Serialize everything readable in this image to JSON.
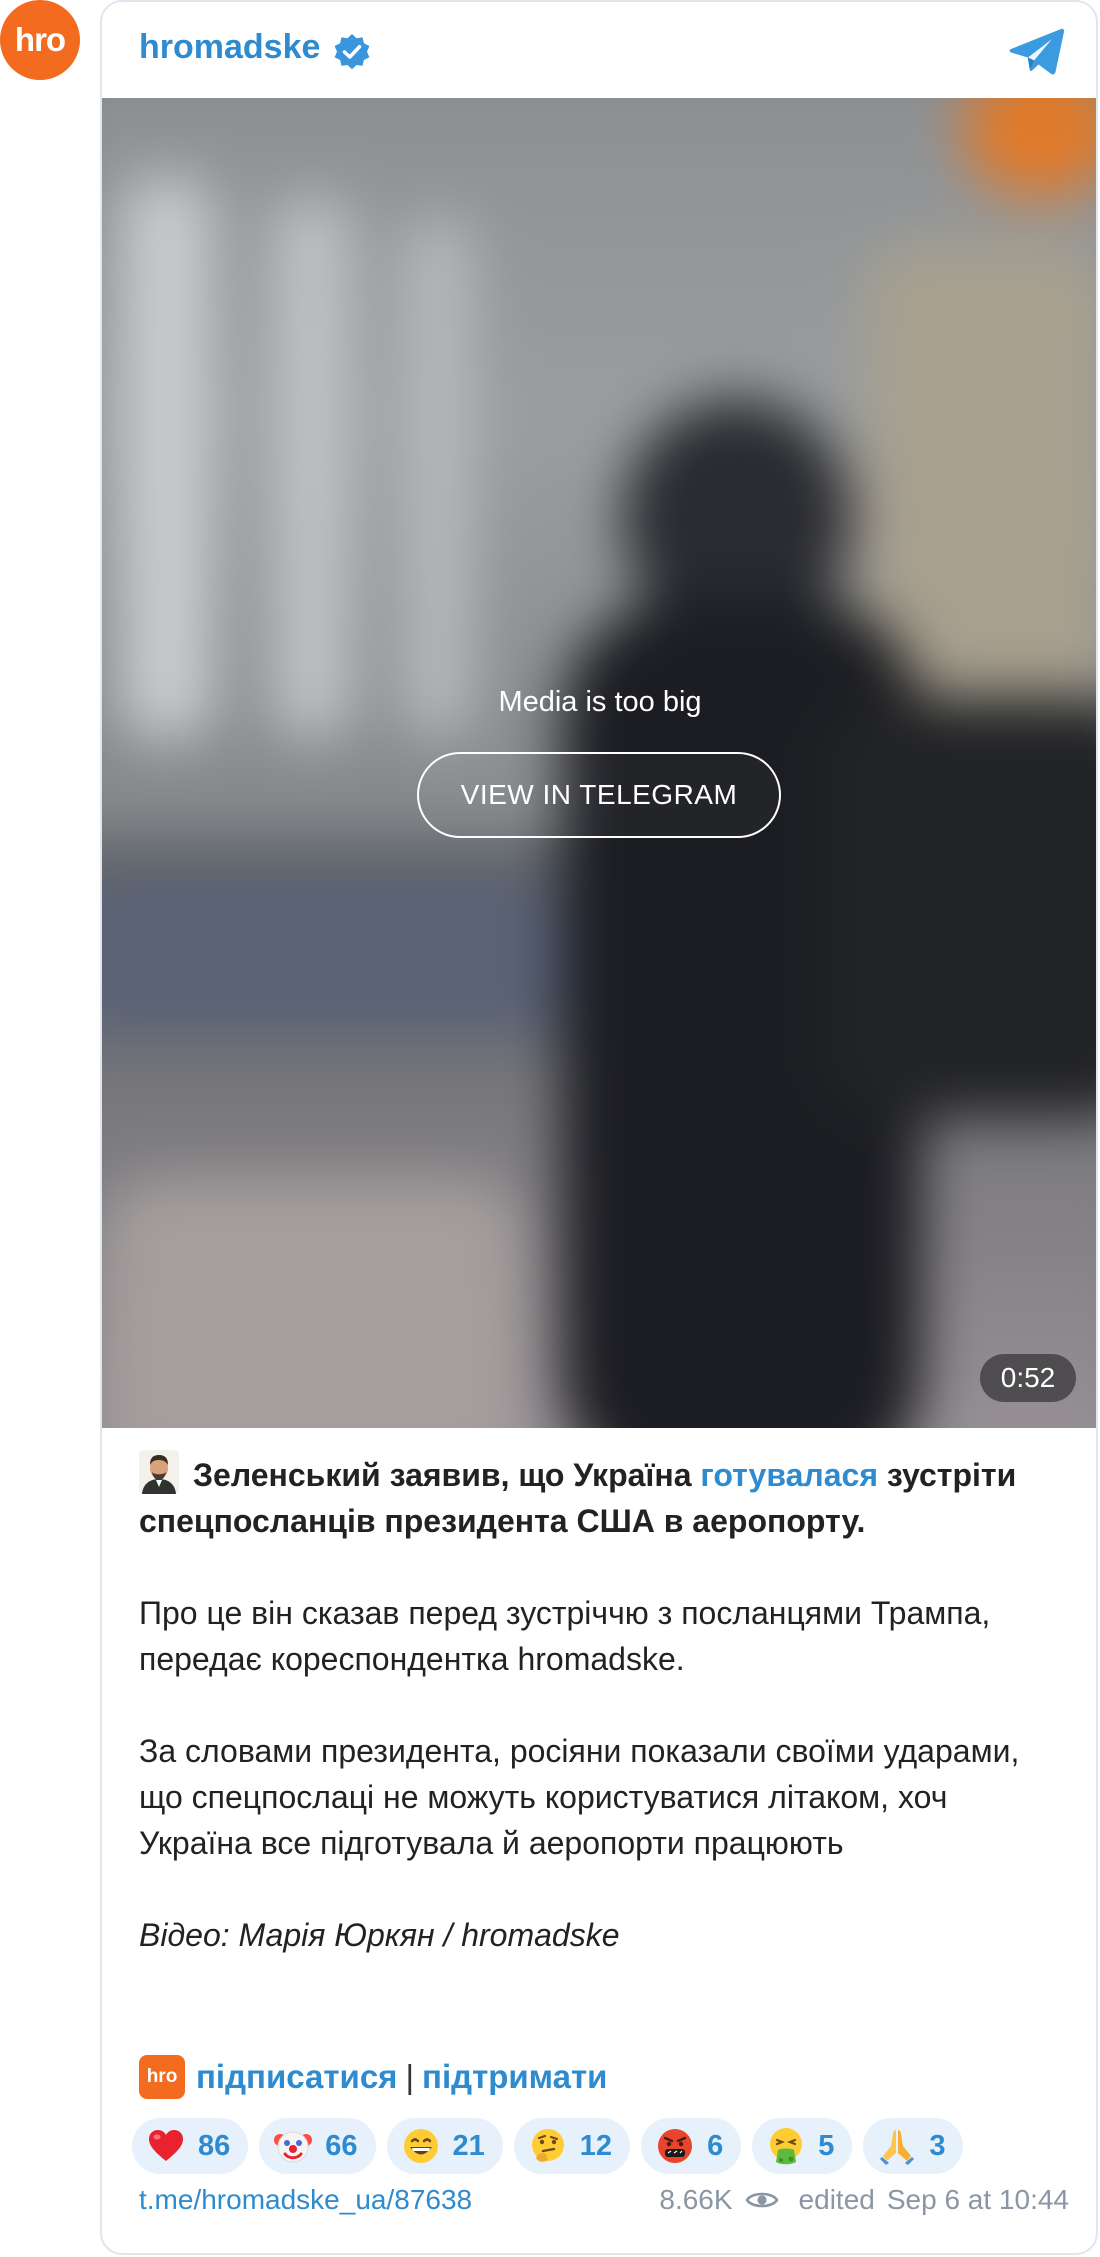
{
  "channel": {
    "avatar_text": "hro",
    "name": "hromadske",
    "verified_icon": "verified-badge-icon",
    "platform_icon": "telegram-icon"
  },
  "media": {
    "message": "Media is too big",
    "button_label": "VIEW IN TELEGRAM",
    "duration": "0:52"
  },
  "post": {
    "headline_pre": "Зеленський заявив, що Україна ",
    "headline_link": "готувалася",
    "headline_post": " зустріти спецпосланців президента США в аеропорту.",
    "paragraph_2": "Про це він сказав перед зустріччю з посланцями Трампа, передає кореспондентка hromadske.",
    "paragraph_3": "За словами президента, росіяни показали своїми ударами, що спецпослаці не можуть користуватися літаком, хоч Україна все підготувала й аеропорти працюють",
    "credit": "Відео: Марія Юркян / hromadske"
  },
  "subscribe": {
    "badge_text": "hro",
    "subscribe_label": "підписатися",
    "separator": "|",
    "support_label": "підтримати"
  },
  "reactions": [
    {
      "emoji": "red-heart",
      "count": "86"
    },
    {
      "emoji": "clown-face",
      "count": "66"
    },
    {
      "emoji": "grinning-face",
      "count": "21"
    },
    {
      "emoji": "thinking-face",
      "count": "12"
    },
    {
      "emoji": "cursing-face",
      "count": "6"
    },
    {
      "emoji": "vomiting-face",
      "count": "5"
    },
    {
      "emoji": "folded-hands",
      "count": "3"
    }
  ],
  "footer": {
    "permalink": "t.me/hromadske_ua/87638",
    "views": "8.66K",
    "edited": "edited",
    "date": "Sep 6 at 10:44"
  },
  "colors": {
    "brand_orange": "#f26b1f",
    "link_blue": "#2e8bcf",
    "reaction_bg": "#e7f1fb",
    "meta_gray": "#8a96a3"
  }
}
